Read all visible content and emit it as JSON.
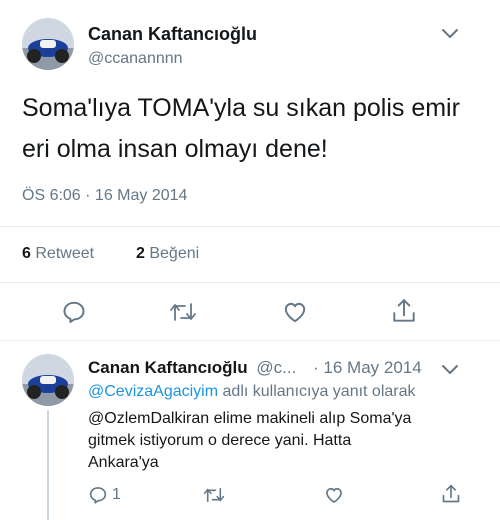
{
  "main_tweet": {
    "author_name": "Canan Kaftancıoğlu",
    "handle": "@ccanannnn",
    "text_line1": "Soma'lıya TOMA'yla su sıkan polis emir",
    "text_line2": "eri olma insan olmayı dene!",
    "timestamp": "ÖS 6:06 · 16 May 2014",
    "stats": {
      "retweet_count": "6",
      "retweet_label": "Retweet",
      "like_count": "2",
      "like_label": "Beğeni"
    }
  },
  "reply_tweet": {
    "author_name": "Canan Kaftancıoğlu",
    "handle": "@c...",
    "date": "· 16 May 2014",
    "reply_mention": "@CevizaAgaciyim",
    "reply_suffix": "adlı kullanıcıya yanıt olarak",
    "mention": "@OzlemDalkiran",
    "text_line1_rest": "elime makineli alıp Soma'ya",
    "text_line2": "gitmek istiyorum o derece yani. Hatta",
    "text_line3": "Ankara'ya",
    "reply_count": "1"
  },
  "icons": [
    "chevron-down-icon",
    "reply-icon",
    "retweet-icon",
    "like-icon",
    "share-icon"
  ],
  "colors": {
    "link": "#1b95e0",
    "muted": "#657786",
    "text": "#14171a",
    "divider": "#e6ecf0"
  }
}
